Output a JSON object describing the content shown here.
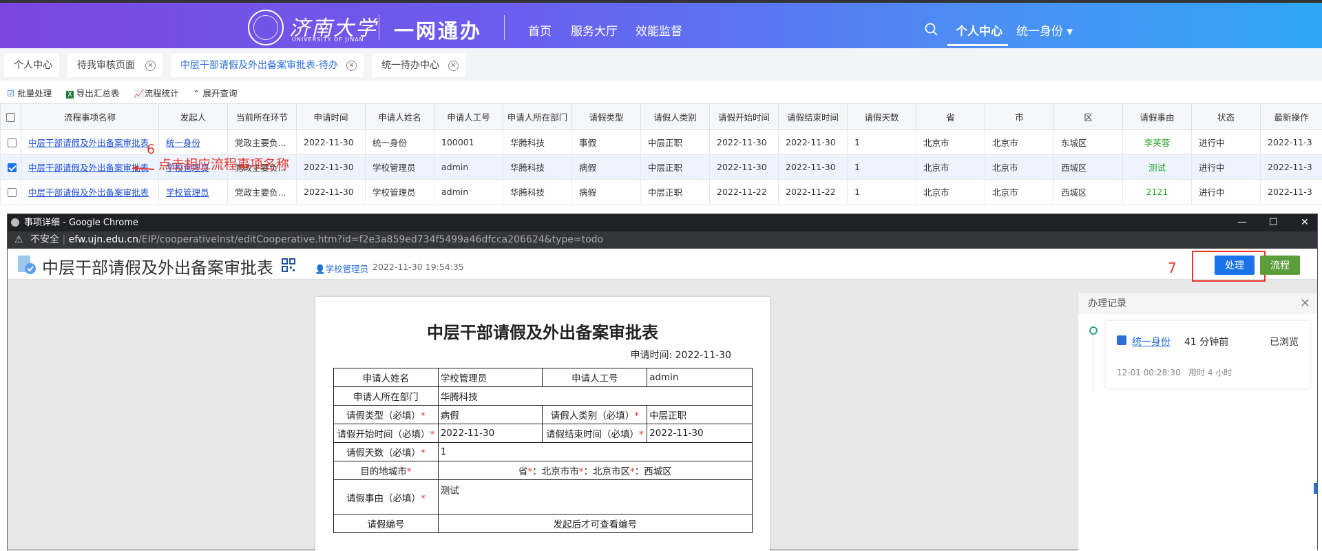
{
  "header": {
    "logo_cn": "济南大学",
    "logo_en": "UNIVERSITY OF JINAN",
    "system_name": "一网通办",
    "nav": [
      "首页",
      "服务大厅",
      "效能监督"
    ],
    "right_nav_active": "个人中心",
    "user_menu": "统一身份 ▾"
  },
  "tabs": [
    {
      "label": "个人中心",
      "closable": false
    },
    {
      "label": "待我审核页面",
      "closable": true
    },
    {
      "label": "中层干部请假及外出备案审批表-待办",
      "closable": true,
      "active": true
    },
    {
      "label": "统一待办中心",
      "closable": true
    }
  ],
  "toolbar": {
    "batch": "批量处理",
    "export": "导出汇总表",
    "stats": "流程统计",
    "expand": "展开查询"
  },
  "table": {
    "headers": [
      "流程事项名称",
      "发起人",
      "当前所在环节",
      "申请时间",
      "申请人姓名",
      "申请人工号",
      "申请人所在部门",
      "请假类型",
      "请假人类别",
      "请假开始时间",
      "请假结束时间",
      "请假天数",
      "省",
      "市",
      "区",
      "请假事由",
      "状态",
      "最新操作"
    ],
    "rows": [
      {
        "checked": false,
        "cells": [
          "中层干部请假及外出备案审批表",
          "统一身份",
          "党政主要负...",
          "2022-11-30",
          "统一身份",
          "100001",
          "华腾科技",
          "事假",
          "中层正职",
          "2022-11-30",
          "2022-11-30",
          "1",
          "北京市",
          "北京市",
          "东城区",
          "李芙蓉",
          "进行中",
          "2022-11-3"
        ]
      },
      {
        "checked": true,
        "cells": [
          "中层干部请假及外出备案审批表",
          "学校管理员",
          "党政主要负...",
          "2022-11-30",
          "学校管理员",
          "admin",
          "华腾科技",
          "病假",
          "中层正职",
          "2022-11-30",
          "2022-11-30",
          "1",
          "北京市",
          "北京市",
          "西城区",
          "测试",
          "进行中",
          "2022-11-3"
        ]
      },
      {
        "checked": false,
        "cells": [
          "中层干部请假及外出备案审批表",
          "学校管理员",
          "党政主要负...",
          "2022-11-30",
          "学校管理员",
          "admin",
          "华腾科技",
          "病假",
          "中层正职",
          "2022-11-22",
          "2022-11-22",
          "1",
          "北京市",
          "北京市",
          "西城区",
          "2121",
          "进行中",
          "2022-11-3"
        ]
      }
    ]
  },
  "annotation6": {
    "num": "6",
    "text": "点击相应流程事项名称"
  },
  "chrome": {
    "window_title": "事项详细 - Google Chrome",
    "insecure": "不安全",
    "url_domain": "efw.ujn.edu.cn",
    "url_path": "/EIP/cooperativeInst/editCooperative.htm?id=f2e3a859ed734f5499a46dfcca206624&type=todo"
  },
  "detail": {
    "title": "中层干部请假及外出备案审批表",
    "user": "学校管理员",
    "time": "2022-11-30 19:54:35",
    "process_btn": "处理",
    "flow_btn": "流程",
    "annotation7": "7"
  },
  "form": {
    "title": "中层干部请假及外出备案审批表",
    "date_label": "申请时间: ",
    "date_value": "2022-11-30",
    "applicant_name_label": "申请人姓名",
    "applicant_name": "学校管理员",
    "applicant_id_label": "申请人工号",
    "applicant_id": "admin",
    "dept_label": "申请人所在部门",
    "dept": "华腾科技",
    "leave_type_label": "请假类型（必填）",
    "leave_type": "病假",
    "leaver_cat_label": "请假人类别（必填）",
    "leaver_cat": "中层正职",
    "start_label": "请假开始时间（必填）",
    "start": "2022-11-30",
    "end_label": "请假结束时间（必填）",
    "end": "2022-11-30",
    "days_label": "请假天数（必填）",
    "days": "1",
    "dest_label": "目的地城市",
    "dest_prov_label": "省",
    "dest_prov": "北京市",
    "dest_city_label": "市",
    "dest_city": "北京市",
    "dest_dist_label": "区",
    "dest_dist": "西城区",
    "reason_label": "请假事由（必填）",
    "reason": "测试",
    "number_label": "请假编号",
    "number": "发起后才可查看编号"
  },
  "record_panel": {
    "title": "办理记录",
    "user": "统一身份",
    "ago": "41 分钟前",
    "status": "已浏览",
    "time": "12-01 00:28:30",
    "duration": "用时 4 小时"
  },
  "colors": {
    "accent": "#1a73e8",
    "flow": "#5a9d3a",
    "annotation": "#e8352a",
    "status_ok": "#2aa52a"
  }
}
